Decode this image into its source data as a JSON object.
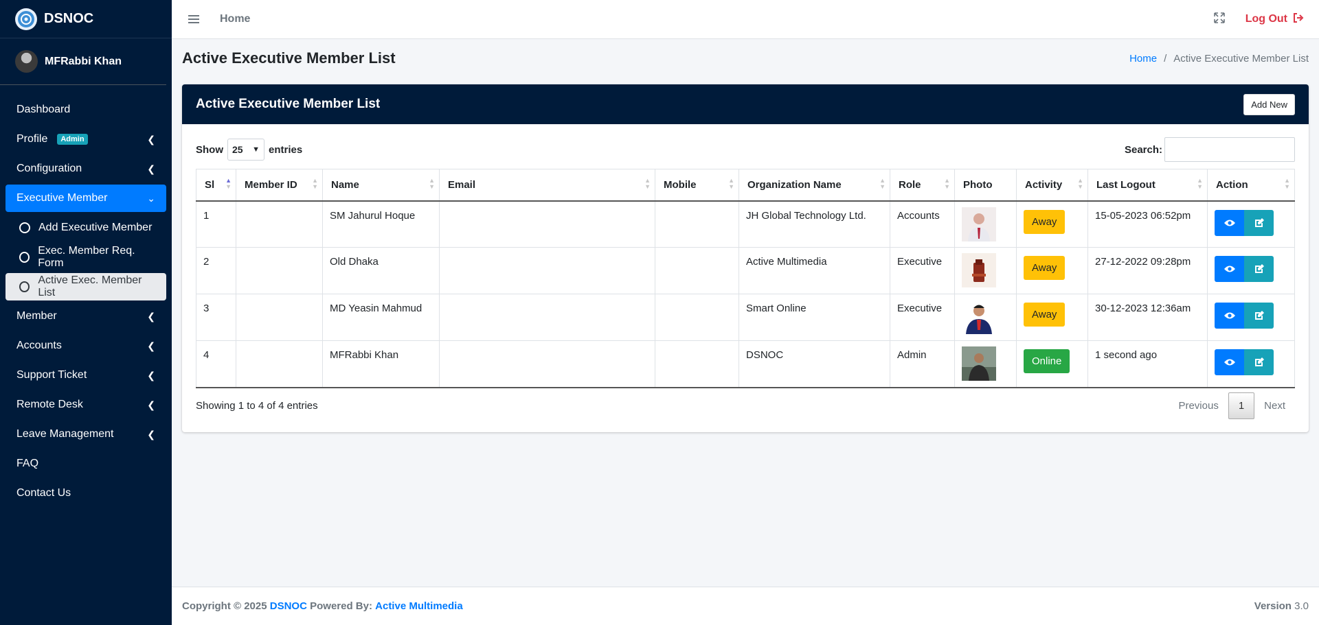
{
  "brand": {
    "name": "DSNOC",
    "logo_icon": "dsnoc-logo-icon"
  },
  "user": {
    "name": "MFRabbi Khan"
  },
  "sidebar": {
    "items": [
      {
        "label": "Dashboard"
      },
      {
        "label": "Profile",
        "badge": "Admin"
      },
      {
        "label": "Configuration"
      },
      {
        "label": "Executive Member"
      },
      {
        "label": "Add Executive Member"
      },
      {
        "label": "Exec. Member Req. Form"
      },
      {
        "label": "Active Exec. Member List"
      },
      {
        "label": "Member"
      },
      {
        "label": "Accounts"
      },
      {
        "label": "Support Ticket"
      },
      {
        "label": "Remote Desk"
      },
      {
        "label": "Leave Management"
      },
      {
        "label": "FAQ"
      },
      {
        "label": "Contact Us"
      }
    ]
  },
  "topbar": {
    "home": "Home",
    "logout": "Log Out"
  },
  "page": {
    "title": "Active Executive Member List",
    "breadcrumb": {
      "home": "Home",
      "separator": "/",
      "current": "Active Executive Member List"
    }
  },
  "card": {
    "title": "Active Executive Member List",
    "add_button": "Add New",
    "show_label": "Show",
    "show_value": "25",
    "entries_label": "entries",
    "search_label": "Search:",
    "search_value": ""
  },
  "table": {
    "headers": [
      "Sl",
      "Member ID",
      "Name",
      "Email",
      "Mobile",
      "Organization Name",
      "Role",
      "Photo",
      "Activity",
      "Last Logout",
      "Action"
    ],
    "rows": [
      {
        "sl": "1",
        "member_id": "",
        "name": "SM Jahurul Hoque",
        "email": "",
        "mobile": "",
        "org": "JH Global Technology Ltd.",
        "role": "Accounts",
        "activity": "Away",
        "last_logout": "15-05-2023 06:52pm"
      },
      {
        "sl": "2",
        "member_id": "",
        "name": "Old Dhaka",
        "email": "",
        "mobile": "",
        "org": "Active Multimedia",
        "role": "Executive",
        "activity": "Away",
        "last_logout": "27-12-2022 09:28pm"
      },
      {
        "sl": "3",
        "member_id": "",
        "name": "MD Yeasin Mahmud",
        "email": "",
        "mobile": "",
        "org": "Smart Online",
        "role": "Executive",
        "activity": "Away",
        "last_logout": "30-12-2023 12:36am"
      },
      {
        "sl": "4",
        "member_id": "",
        "name": "MFRabbi Khan",
        "email": "",
        "mobile": "",
        "org": "DSNOC",
        "role": "Admin",
        "activity": "Online",
        "last_logout": "1 second ago"
      }
    ],
    "info": "Showing 1 to 4 of 4 entries",
    "pager": {
      "previous": "Previous",
      "current": "1",
      "next": "Next"
    }
  },
  "footer": {
    "copyright": "Copyright © 2025",
    "brand": "DSNOC",
    "powered_label": "Powered By:",
    "powered_by": "Active Multimedia",
    "version_label": "Version",
    "version": "3.0"
  },
  "colors": {
    "sidebar_bg": "#001b3a",
    "primary": "#007bff",
    "info": "#17a2b8",
    "warning": "#ffc107",
    "success": "#28a745",
    "danger": "#dc3545"
  }
}
